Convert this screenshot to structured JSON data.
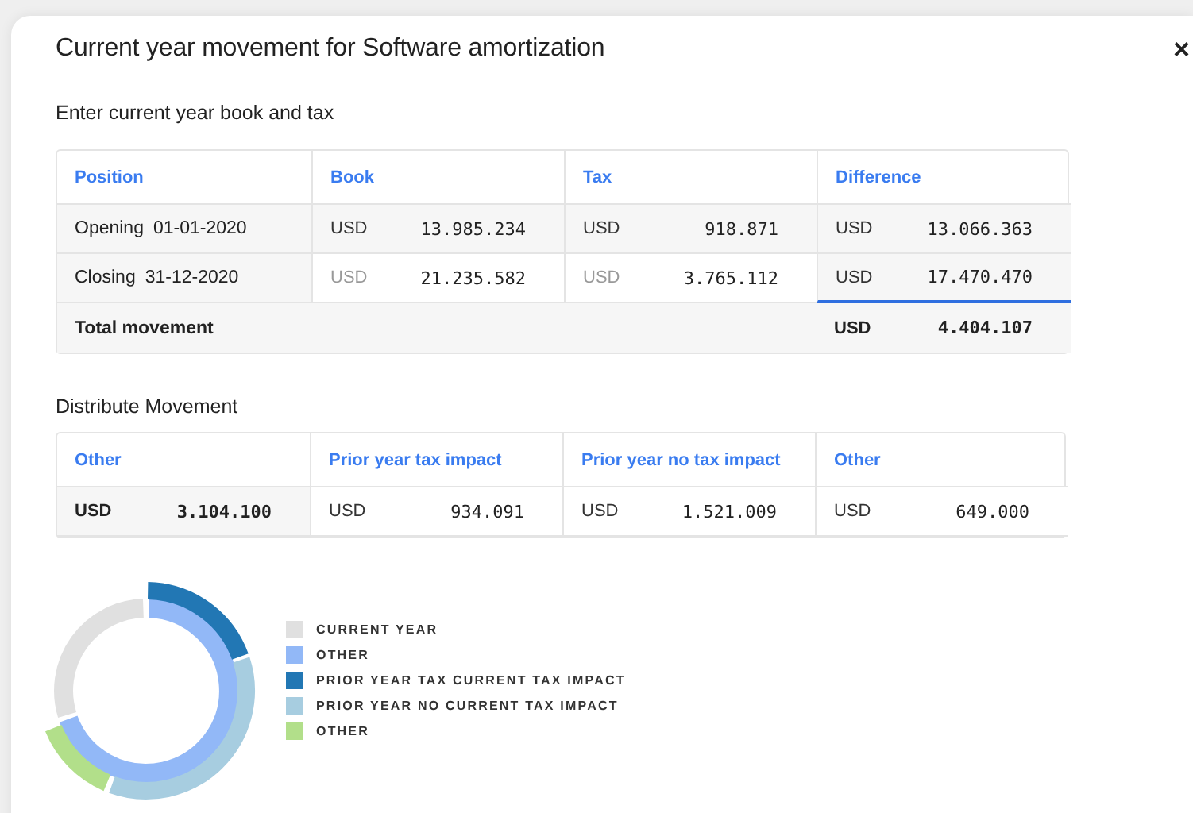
{
  "dialog": {
    "title": "Current year movement for Software amortization",
    "close": "×"
  },
  "book_tax": {
    "heading": "Enter current year book and tax",
    "columns": [
      "Position",
      "Book",
      "Tax",
      "Difference"
    ],
    "rows": [
      {
        "cells": [
          {
            "kind": "position",
            "label": "Opening",
            "date": "01-01-2020"
          },
          {
            "kind": "value",
            "currency": "USD",
            "amount": "13.985.234",
            "focused": false
          },
          {
            "kind": "value",
            "currency": "USD",
            "amount": "918.871",
            "focused": false
          },
          {
            "kind": "value",
            "currency": "USD",
            "amount": "13.066.363",
            "focused": false
          }
        ]
      },
      {
        "cells": [
          {
            "kind": "position",
            "label": "Closing",
            "date": "31-12-2020"
          },
          {
            "kind": "input",
            "currency": "USD",
            "amount": "21.235.582",
            "focused": false
          },
          {
            "kind": "input",
            "currency": "USD",
            "amount": "3.765.112",
            "focused": false
          },
          {
            "kind": "value",
            "currency": "USD",
            "amount": "17.470.470",
            "focused": true
          }
        ]
      }
    ],
    "total": {
      "label": "Total movement",
      "currency": "USD",
      "amount": "4.404.107"
    }
  },
  "distribute": {
    "heading": "Distribute Movement",
    "columns": [
      {
        "label": "Other",
        "currency": "USD",
        "amount": "3.104.100",
        "kind": "total"
      },
      {
        "label": "Prior year tax impact",
        "currency": "USD",
        "amount": "934.091",
        "kind": "value"
      },
      {
        "label": "Prior year no tax impact",
        "currency": "USD",
        "amount": "1.521.009",
        "kind": "value"
      },
      {
        "label": "Other",
        "currency": "USD",
        "amount": "649.000",
        "kind": "value"
      }
    ]
  },
  "legend": [
    {
      "label": "CURRENT YEAR",
      "color": "#e0e0e0"
    },
    {
      "label": "OTHER",
      "color": "#92b8f7"
    },
    {
      "label": "PRIOR YEAR TAX CURRENT TAX IMPACT",
      "color": "#2277b4"
    },
    {
      "label": "PRIOR YEAR NO CURRENT TAX IMPACT",
      "color": "#a7cde0"
    },
    {
      "label": "OTHER",
      "color": "#b2df8a"
    }
  ]
}
